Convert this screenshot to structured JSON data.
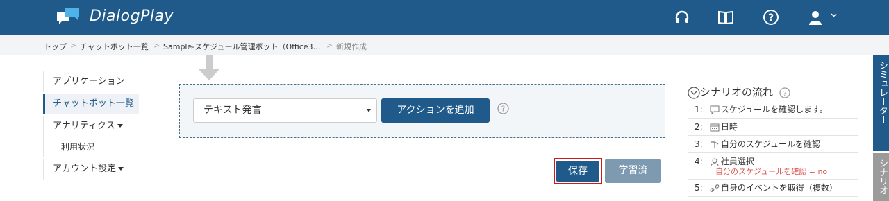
{
  "header": {
    "app_name": "DialogPlay",
    "icons": [
      "headset-icon",
      "book-icon",
      "help-icon",
      "user-icon",
      "chevron-down-icon"
    ]
  },
  "breadcrumb": {
    "items": [
      "トップ",
      "チャットボット一覧",
      "Sample-スケジュール管理ボット（Office3…",
      "新規作成"
    ],
    "separator": ">"
  },
  "sidebar": {
    "items": [
      {
        "label": "アプリケーション"
      },
      {
        "label": "チャットボット一覧",
        "active": true
      },
      {
        "label": "アナリティクス"
      },
      {
        "label": "利用状況"
      },
      {
        "label": "アカウント設定"
      }
    ]
  },
  "action": {
    "select_value": "テキスト発言",
    "add_button": "アクションを追加"
  },
  "buttons": {
    "save": "保存",
    "learned": "学習済"
  },
  "scenario": {
    "title": "シナリオの流れ",
    "steps": [
      {
        "num": "1:",
        "label": "スケジュールを確認します。",
        "icon": "speech-bubble-icon"
      },
      {
        "num": "2:",
        "label": "日時",
        "icon": "calendar-icon"
      },
      {
        "num": "3:",
        "label": "自分のスケジュールを確認",
        "icon": "branch-icon"
      },
      {
        "num": "4:",
        "label": "社員選択",
        "icon": "group-icon",
        "condition": "自分のスケジュールを確認 = no"
      },
      {
        "num": "5:",
        "label": "自身のイベントを取得（複数）",
        "icon": "link-icon"
      }
    ]
  },
  "side_tabs": {
    "simulator": "シミュレーター",
    "scenario": "シナリオ"
  },
  "colors": {
    "header_bg": "#1f5a8a",
    "primary": "#1f5a8a",
    "disabled_button": "#7d9ab0",
    "highlight_border": "#cc1b1b",
    "condition_text": "#d9534f"
  }
}
